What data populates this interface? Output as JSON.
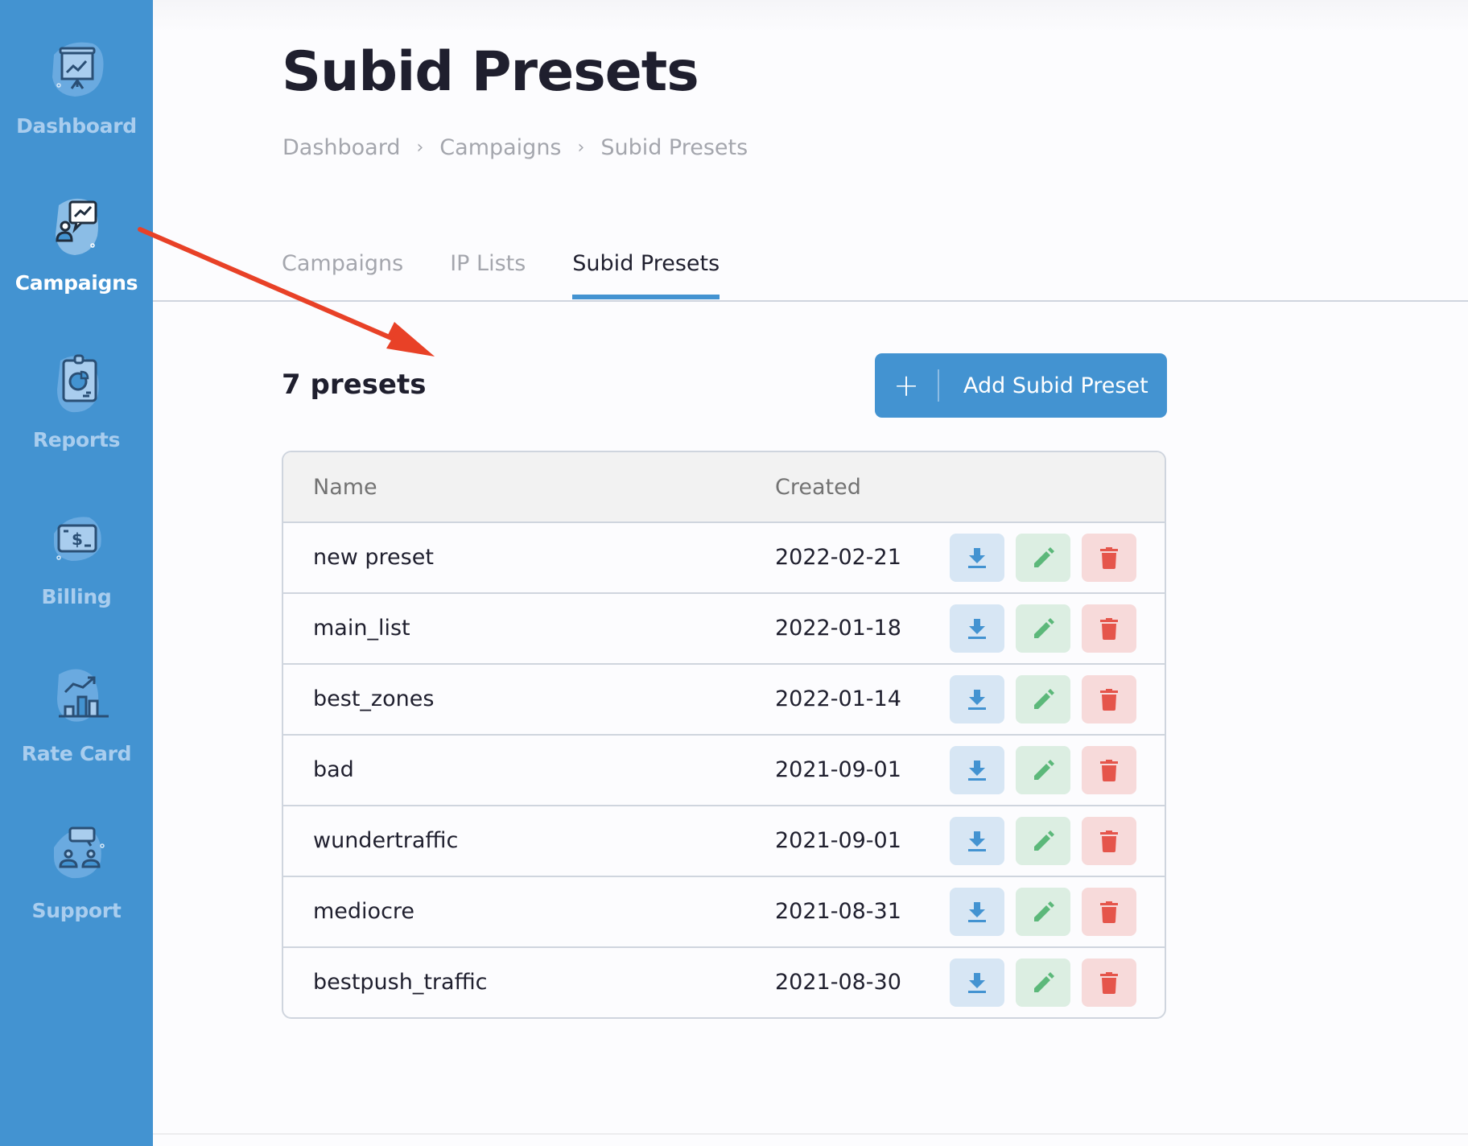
{
  "sidebar": {
    "items": [
      {
        "label": "Dashboard",
        "icon": "presentation-board-icon",
        "active": false
      },
      {
        "label": "Campaigns",
        "icon": "presenter-chart-icon",
        "active": true
      },
      {
        "label": "Reports",
        "icon": "clipboard-pie-chart-icon",
        "active": false
      },
      {
        "label": "Billing",
        "icon": "dollar-bill-icon",
        "active": false
      },
      {
        "label": "Rate Card",
        "icon": "bar-chart-trend-icon",
        "active": false
      },
      {
        "label": "Support",
        "icon": "people-chat-icon",
        "active": false
      }
    ]
  },
  "header": {
    "title": "Subid Presets",
    "breadcrumb": [
      {
        "label": "Dashboard"
      },
      {
        "label": "Campaigns"
      },
      {
        "label": "Subid Presets"
      }
    ],
    "breadcrumb_separator": "›"
  },
  "tabs": [
    {
      "label": "Campaigns",
      "active": false
    },
    {
      "label": "IP Lists",
      "active": false
    },
    {
      "label": "Subid Presets",
      "active": true
    }
  ],
  "toolbar": {
    "count_label": "7 presets",
    "add_button_icon": "+",
    "add_button_label": "Add Subid Preset"
  },
  "table": {
    "columns": [
      "Name",
      "Created"
    ],
    "actions": [
      "download",
      "edit",
      "delete"
    ],
    "rows": [
      {
        "name": "new preset",
        "created": "2022-02-21"
      },
      {
        "name": "main_list",
        "created": "2022-01-18"
      },
      {
        "name": "best_zones",
        "created": "2022-01-14"
      },
      {
        "name": "bad",
        "created": "2021-09-01"
      },
      {
        "name": "wundertraffic",
        "created": "2021-09-01"
      },
      {
        "name": "mediocre",
        "created": "2021-08-31"
      },
      {
        "name": "bestpush_traffic",
        "created": "2021-08-30"
      }
    ]
  },
  "colors": {
    "sidebar": "#4393d1",
    "accent": "#4393d1",
    "download": "#4393d1",
    "edit": "#5cb87a",
    "delete": "#e5554b",
    "annotation_arrow": "#e84127"
  }
}
